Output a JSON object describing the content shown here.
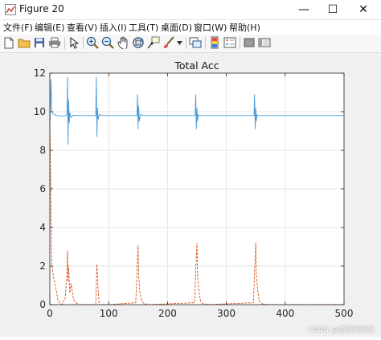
{
  "window": {
    "title": "Figure 20",
    "min_glyph": "—",
    "max_glyph": "☐",
    "close_glyph": "✕"
  },
  "menu": [
    "文件(F)",
    "编辑(E)",
    "查看(V)",
    "插入(I)",
    "工具(T)",
    "桌面(D)",
    "窗口(W)",
    "帮助(H)"
  ],
  "toolbar_icons": [
    "new-figure-icon",
    "open-file-icon",
    "save-icon",
    "print-icon",
    "edit-plot-arrow-icon",
    "zoom-in-icon",
    "zoom-out-icon",
    "pan-hand-icon",
    "rotate-3d-icon",
    "data-cursor-icon",
    "brush-icon",
    "brush-dropdown-icon",
    "link-plot-icon",
    "insert-colorbar-icon",
    "insert-legend-icon",
    "hide-plot-tools-icon",
    "show-plot-tools-icon"
  ],
  "watermark": "CSDN @荔枝科研社",
  "chart_data": {
    "type": "line",
    "title": "Total Acc",
    "xlabel": "",
    "ylabel": "",
    "xlim": [
      0,
      500
    ],
    "ylim": [
      0,
      12
    ],
    "xticks": [
      0,
      100,
      200,
      300,
      400,
      500
    ],
    "yticks": [
      0,
      2,
      4,
      6,
      8,
      10,
      12
    ],
    "grid": true,
    "series": [
      {
        "color": "#4a9ad6",
        "style": "solid",
        "x": [
          0,
          1,
          2,
          3,
          4,
          5,
          8,
          12,
          20,
          29,
          30,
          31,
          32,
          33,
          34,
          36,
          40,
          50,
          60,
          78,
          79,
          80,
          81,
          82,
          84,
          90,
          100,
          120,
          148,
          149,
          150,
          151,
          152,
          154,
          160,
          180,
          220,
          247,
          248,
          249,
          250,
          251,
          252,
          254,
          260,
          300,
          347,
          348,
          349,
          350,
          351,
          352,
          354,
          360,
          400,
          450,
          500
        ],
        "y": [
          9.3,
          10.4,
          11.7,
          10.2,
          10.0,
          9.9,
          9.85,
          9.8,
          9.78,
          9.8,
          11.8,
          8.3,
          10.6,
          9.4,
          9.95,
          9.7,
          9.82,
          9.8,
          9.8,
          9.8,
          11.8,
          8.7,
          10.2,
          9.6,
          9.85,
          9.8,
          9.8,
          9.8,
          9.8,
          10.9,
          9.1,
          10.3,
          9.5,
          9.85,
          9.8,
          9.8,
          9.8,
          9.8,
          10.9,
          9.1,
          10.2,
          9.5,
          9.85,
          9.8,
          9.8,
          9.8,
          9.8,
          10.9,
          9.1,
          10.2,
          9.5,
          9.85,
          9.8,
          9.8,
          9.8,
          9.8,
          9.8
        ]
      },
      {
        "color": "#d95319",
        "style": "dashed",
        "x": [
          0,
          1,
          2,
          3,
          4,
          6,
          10,
          14,
          20,
          26,
          29,
          30,
          31,
          32,
          34,
          36,
          40,
          44,
          50,
          60,
          78,
          80,
          82,
          84,
          88,
          100,
          146,
          149,
          150,
          151,
          153,
          156,
          160,
          170,
          246,
          249,
          250,
          251,
          253,
          256,
          260,
          270,
          346,
          349,
          350,
          351,
          353,
          356,
          360,
          370,
          500
        ],
        "y": [
          9.7,
          7.4,
          4.8,
          2.5,
          1.9,
          1.5,
          0.9,
          0.2,
          0.0,
          0.3,
          1.6,
          2.8,
          1.2,
          2.0,
          0.6,
          1.1,
          0.3,
          0.1,
          0.0,
          0.0,
          0.0,
          2.1,
          0.8,
          0.0,
          0.0,
          0.0,
          0.1,
          2.4,
          3.1,
          1.5,
          0.7,
          0.2,
          0.05,
          0.0,
          0.1,
          2.6,
          3.2,
          1.6,
          0.8,
          0.2,
          0.05,
          0.0,
          0.1,
          2.5,
          3.2,
          1.6,
          0.8,
          0.2,
          0.05,
          0.0,
          0.0
        ]
      }
    ]
  }
}
